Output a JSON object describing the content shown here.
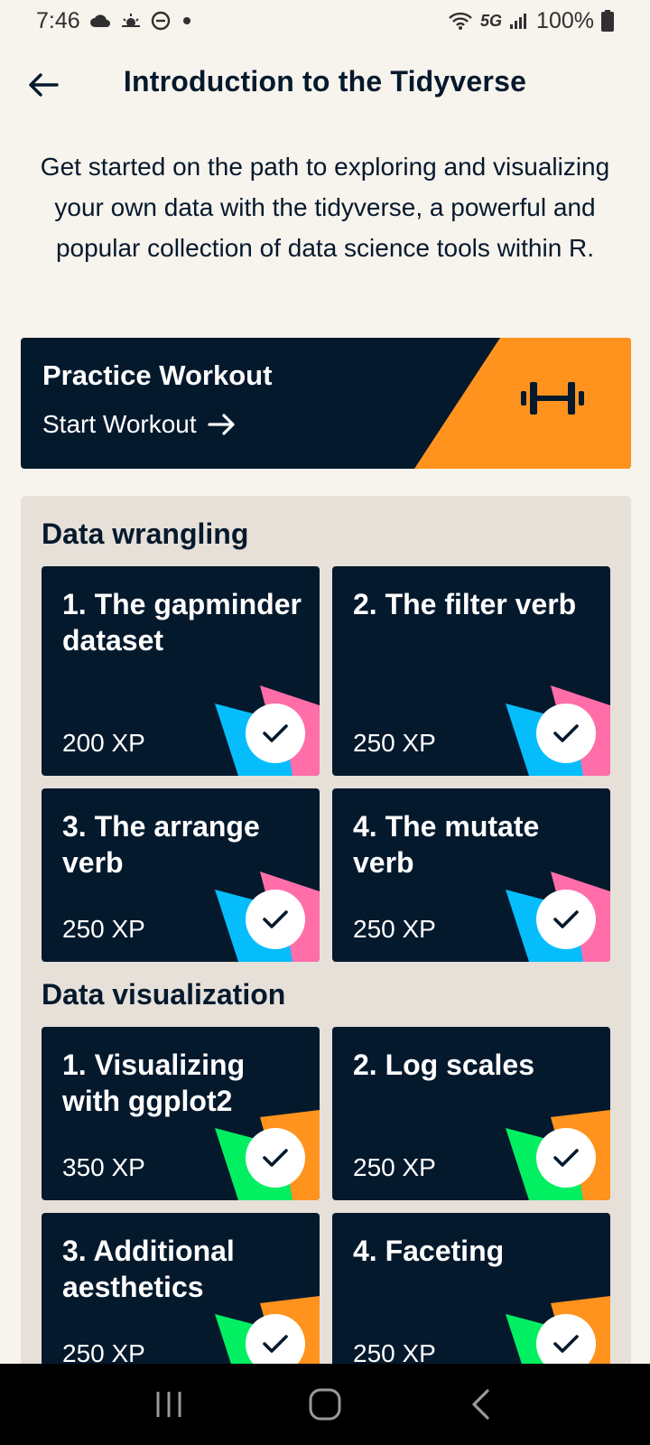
{
  "status": {
    "time": "7:46",
    "network": "5G",
    "battery": "100%"
  },
  "header": {
    "title": "Introduction to the Tidyverse"
  },
  "description": "Get started on the path to exploring and visualizing your own data with the tidyverse, a powerful and popular collection of data science tools within R.",
  "workout": {
    "title": "Practice Workout",
    "start_label": "Start Workout",
    "accent": "#ff931e"
  },
  "sections": [
    {
      "title": "Data wrangling",
      "lessons": [
        {
          "title": "1. The gapminder dataset",
          "xp": "200 XP"
        },
        {
          "title": "2. The filter verb",
          "xp": "250 XP"
        },
        {
          "title": "3. The arrange verb",
          "xp": "250 XP"
        },
        {
          "title": "4. The mutate verb",
          "xp": "250 XP"
        }
      ]
    },
    {
      "title": "Data visualization",
      "lessons": [
        {
          "title": "1. Visualizing with ggplot2",
          "xp": "350 XP"
        },
        {
          "title": "2. Log scales",
          "xp": "250 XP"
        },
        {
          "title": "3. Additional aesthetics",
          "xp": "250 XP"
        },
        {
          "title": "4. Faceting",
          "xp": "250 XP"
        }
      ]
    }
  ],
  "colors": {
    "navy": "#05192d",
    "background": "#f7f3ed",
    "panel": "#e6e0d9",
    "cyan": "#03ef62",
    "blue": "#06bdfc",
    "pink": "#ff6ea9",
    "green": "#03ef62",
    "orange": "#ff931e"
  }
}
